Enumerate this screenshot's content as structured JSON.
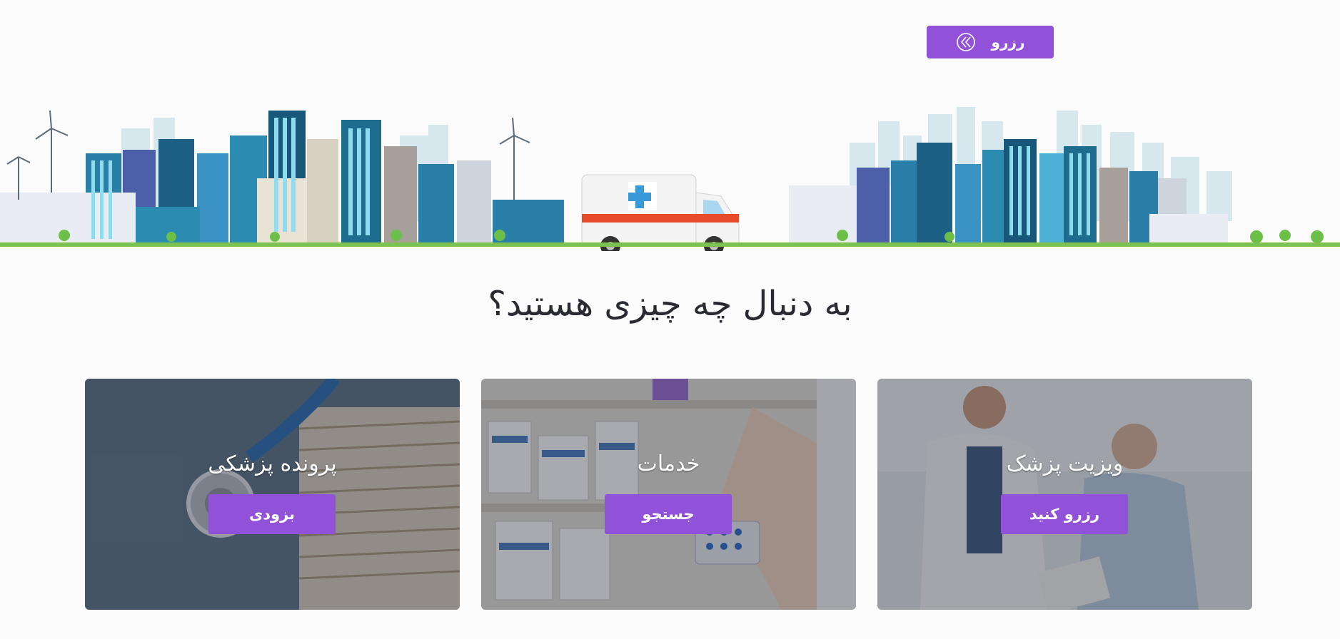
{
  "header": {
    "reserve_button_label": "رزرو",
    "reserve_icon": "double-chevron-left-icon"
  },
  "hero": {
    "illustration": "city-skyline-with-ambulance"
  },
  "main": {
    "headline": "به دنبال چه چیزی هستید؟",
    "cards": [
      {
        "title": "ویزیت پزشک",
        "button": "رزرو کنید",
        "image": "doctor-with-patient"
      },
      {
        "title": "خدمات",
        "button": "جستجو",
        "image": "pharmacy-shelf"
      },
      {
        "title": "پرونده پزشکی",
        "button": "بزودی",
        "image": "stethoscope-and-files"
      }
    ]
  },
  "colors": {
    "accent": "#9152d9",
    "background": "#fbfbfc",
    "headline_text": "#2a2a32"
  }
}
